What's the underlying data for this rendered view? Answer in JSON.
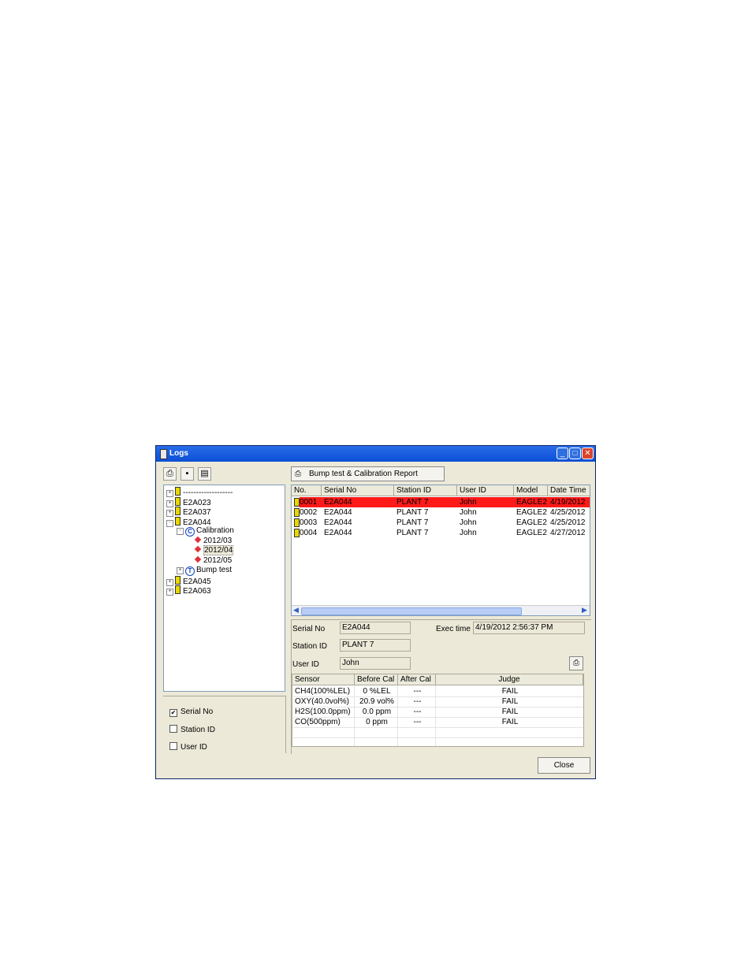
{
  "window": {
    "title": "Logs"
  },
  "toolbar": {
    "icons": [
      "printer-icon",
      "save-icon",
      "clipboard-icon"
    ]
  },
  "tree": {
    "items": [
      {
        "label": "-------------------",
        "level": 0,
        "type": "device",
        "expander": "+"
      },
      {
        "label": "E2A023",
        "level": 0,
        "type": "device",
        "expander": "+"
      },
      {
        "label": "E2A037",
        "level": 0,
        "type": "device",
        "expander": "+"
      },
      {
        "label": "E2A044",
        "level": 0,
        "type": "device",
        "expander": "-"
      },
      {
        "label": "Calibration",
        "level": 1,
        "type": "calibration",
        "expander": "-",
        "badge": "C"
      },
      {
        "label": "2012/03",
        "level": 2,
        "type": "month"
      },
      {
        "label": "2012/04",
        "level": 2,
        "type": "month",
        "selected": true
      },
      {
        "label": "2012/05",
        "level": 2,
        "type": "month"
      },
      {
        "label": "Bump test",
        "level": 1,
        "type": "bump",
        "expander": "+",
        "badge": "T"
      },
      {
        "label": "E2A045",
        "level": 0,
        "type": "device",
        "expander": "+"
      },
      {
        "label": "E2A063",
        "level": 0,
        "type": "device",
        "expander": "+"
      }
    ]
  },
  "filters": [
    {
      "label": "Serial No",
      "checked": true
    },
    {
      "label": "Station ID",
      "checked": false
    },
    {
      "label": "User ID",
      "checked": false
    }
  ],
  "report_button": {
    "label": "Bump test & Calibration Report"
  },
  "log_table": {
    "columns": [
      "No.",
      "Serial No",
      "Station ID",
      "User ID",
      "Model",
      "Date Time"
    ],
    "rows": [
      [
        "0001",
        "E2A044",
        "PLANT 7",
        "John",
        "EAGLE2",
        "4/19/2012"
      ],
      [
        "0002",
        "E2A044",
        "PLANT 7",
        "John",
        "EAGLE2",
        "4/25/2012"
      ],
      [
        "0003",
        "E2A044",
        "PLANT 7",
        "John",
        "EAGLE2",
        "4/25/2012"
      ],
      [
        "0004",
        "E2A044",
        "PLANT 7",
        "John",
        "EAGLE2",
        "4/27/2012"
      ]
    ],
    "selected_row": 0,
    "selected_color": "#ff1a1a"
  },
  "details": {
    "serial_no_label": "Serial No",
    "serial_no": "E2A044",
    "station_id_label": "Station ID",
    "station_id": "PLANT 7",
    "user_id_label": "User ID",
    "user_id": "John",
    "exec_time_label": "Exec time",
    "exec_time": "4/19/2012 2:56:37 PM"
  },
  "sensor_table": {
    "columns": [
      "Sensor",
      "Before Cal",
      "After Cal",
      "Judge"
    ],
    "rows": [
      [
        "CH4(100%LEL)",
        "0 %LEL",
        "---",
        "FAIL"
      ],
      [
        "OXY(40.0vol%)",
        "20.9 vol%",
        "---",
        "FAIL"
      ],
      [
        "H2S(100.0ppm)",
        "0.0 ppm",
        "---",
        "FAIL"
      ],
      [
        "CO(500ppm)",
        "0 ppm",
        "---",
        "FAIL"
      ]
    ]
  },
  "close_button": {
    "label": "Close"
  }
}
